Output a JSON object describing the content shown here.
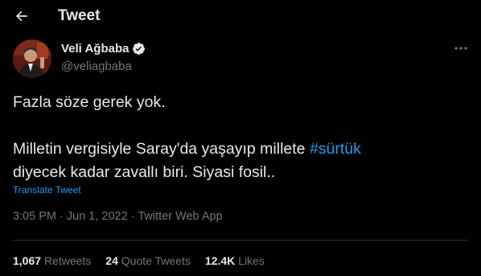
{
  "header": {
    "title": "Tweet",
    "back_icon": "arrow-left-icon"
  },
  "author": {
    "display_name": "Veli Ağbaba",
    "handle": "@veliagbaba",
    "verified": true,
    "verified_icon": "verified-badge-icon"
  },
  "more_icon": "more-horizontal-icon",
  "tweet": {
    "line1": "Fazla söze gerek yok.",
    "line2_prefix": "Milletin vergisiyle Saray'da yaşayıp millete ",
    "hashtag": "#sürtük",
    "line3": "diyecek kadar zavallı biri. Siyasi fosil.."
  },
  "translate_label": "Translate Tweet",
  "meta": {
    "time": "3:05 PM",
    "separator": " · ",
    "date": "Jun 1, 2022",
    "source": "Twitter Web App"
  },
  "stats": {
    "retweets_count": "1,067",
    "retweets_label": "Retweets",
    "quotes_count": "24",
    "quotes_label": "Quote Tweets",
    "likes_count": "12.4K",
    "likes_label": "Likes"
  },
  "colors": {
    "background": "#000000",
    "text": "#e7e9ea",
    "secondary": "#71767b",
    "accent": "#1d9bf0",
    "divider": "#2f3336"
  }
}
